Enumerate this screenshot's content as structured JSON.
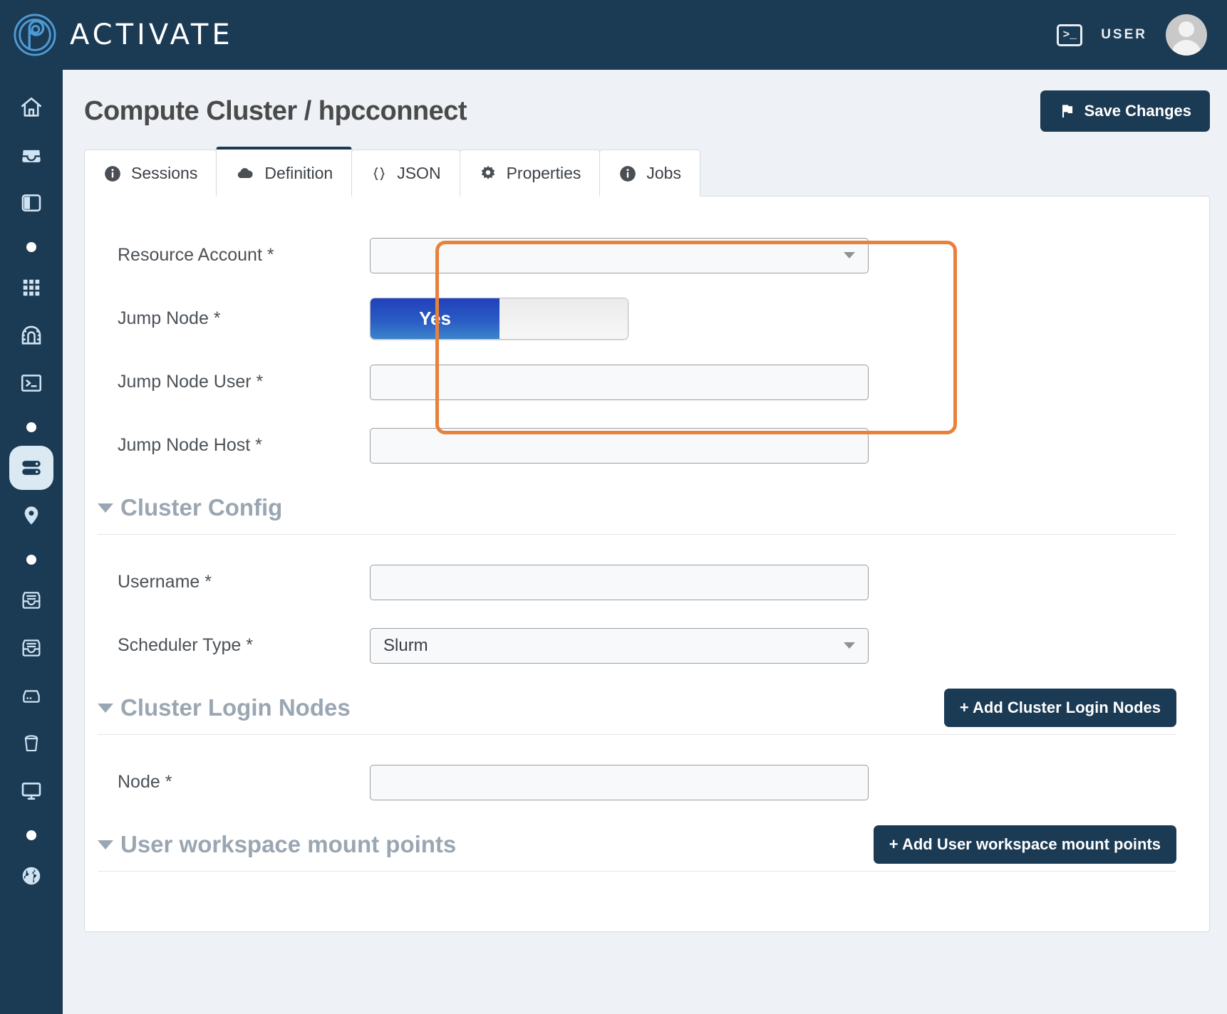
{
  "app": {
    "brand_name": "ACTIVATE",
    "logo_icon": "fingerprint-p-logo",
    "terminal_icon": "terminal-icon",
    "terminal_glyph": ">_",
    "user_label": "USER",
    "avatar_icon": "avatar-icon"
  },
  "sidebar": {
    "items": [
      {
        "icon": "home-icon",
        "active": false
      },
      {
        "icon": "inbox-icon",
        "active": false
      },
      {
        "icon": "layout-columns-icon",
        "active": false
      },
      {
        "icon": "dot-separator-icon",
        "active": false
      },
      {
        "icon": "grid-apps-icon",
        "active": false
      },
      {
        "icon": "tunnel-icon",
        "active": false
      },
      {
        "icon": "terminal-icon",
        "active": false
      },
      {
        "icon": "dot-separator-icon",
        "active": false
      },
      {
        "icon": "server-cluster-icon",
        "active": true
      },
      {
        "icon": "map-pin-icon",
        "active": false
      },
      {
        "icon": "dot-separator-icon",
        "active": false
      },
      {
        "icon": "archive-box-icon",
        "active": false
      },
      {
        "icon": "archive-box-icon",
        "active": false
      },
      {
        "icon": "hard-drive-icon",
        "active": false
      },
      {
        "icon": "bucket-icon",
        "active": false
      },
      {
        "icon": "monitor-icon",
        "active": false
      },
      {
        "icon": "dot-separator-icon",
        "active": false
      },
      {
        "icon": "globe-icon",
        "active": false
      }
    ]
  },
  "header": {
    "title": "Compute Cluster / hpcconnect",
    "save_label": "Save Changes",
    "save_icon": "flag-icon"
  },
  "tabs": [
    {
      "label": "Sessions",
      "icon": "info-icon",
      "active": false
    },
    {
      "label": "Definition",
      "icon": "cloud-icon",
      "active": true
    },
    {
      "label": "JSON",
      "icon": "braces-icon",
      "active": false
    },
    {
      "label": "Properties",
      "icon": "gear-icon",
      "active": false
    },
    {
      "label": "Jobs",
      "icon": "info-icon",
      "active": false
    }
  ],
  "form": {
    "resource_account": {
      "label": "Resource Account *",
      "value": "",
      "placeholder": "",
      "type": "select"
    },
    "jump_node": {
      "label": "Jump Node *",
      "toggle_on_label": "Yes",
      "state": "Yes"
    },
    "jump_node_user": {
      "label": "Jump Node User *",
      "value": "",
      "placeholder": ""
    },
    "jump_node_host": {
      "label": "Jump Node Host *",
      "value": "",
      "placeholder": ""
    },
    "cluster_config": {
      "title": "Cluster Config",
      "chevron": "chevron-down-icon"
    },
    "username": {
      "label": "Username *",
      "value": "",
      "placeholder": ""
    },
    "scheduler_type": {
      "label": "Scheduler Type *",
      "value": "Slurm",
      "type": "select"
    },
    "cluster_login_nodes": {
      "title": "Cluster Login Nodes",
      "chevron": "chevron-down-icon",
      "add_label": "+ Add Cluster Login Nodes"
    },
    "node": {
      "label": "Node *",
      "value": "",
      "placeholder": ""
    },
    "user_workspace_mount_points": {
      "title": "User workspace mount points",
      "chevron": "chevron-down-icon",
      "add_label": "+ Add User workspace mount points"
    }
  },
  "colors": {
    "brand_navy": "#1b3a54",
    "accent_blue": "#2a5cc4",
    "highlight_orange": "#e8813a",
    "section_gray": "#9aa6b2",
    "page_bg": "#eef1f5"
  }
}
